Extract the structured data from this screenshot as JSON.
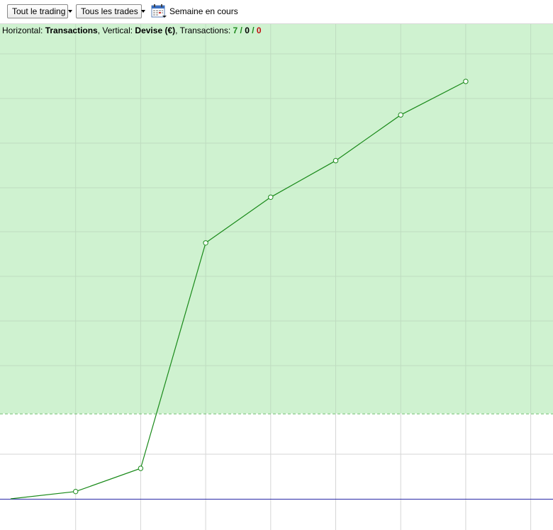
{
  "toolbar": {
    "dropdown1_label": "Tout le trading",
    "dropdown2_label": "Tous les trades",
    "period_label": "Semaine en cours"
  },
  "info": {
    "horizontal_prefix": "Horizontal: ",
    "horizontal_value": "Transactions",
    "vertical_prefix": ", Vertical: ",
    "vertical_value": "Devise (€)",
    "transactions_prefix": ", Transactions: ",
    "wins": "7",
    "sep1": " / ",
    "neutral": "0",
    "sep2": " / ",
    "losses": "0"
  },
  "colors": {
    "positive_area": "#cff2d0",
    "line": "#1a8a1a",
    "baseline": "#2a2aa8",
    "grid": "#bfdcc0",
    "grid_white_area": "#d6d6d6"
  },
  "chart_data": {
    "type": "line",
    "x_label": "Transactions",
    "y_label": "Devise (€)",
    "x": [
      0,
      1,
      2,
      3,
      4,
      5,
      6,
      7
    ],
    "series": [
      {
        "values": [
          0,
          1.2,
          5.0,
          42.0,
          49.5,
          55.5,
          63.0,
          68.5
        ]
      }
    ],
    "xlim": [
      0,
      8.5
    ],
    "ylim": [
      -5,
      78
    ],
    "grid": true,
    "shaded_region_above": 14.0
  }
}
